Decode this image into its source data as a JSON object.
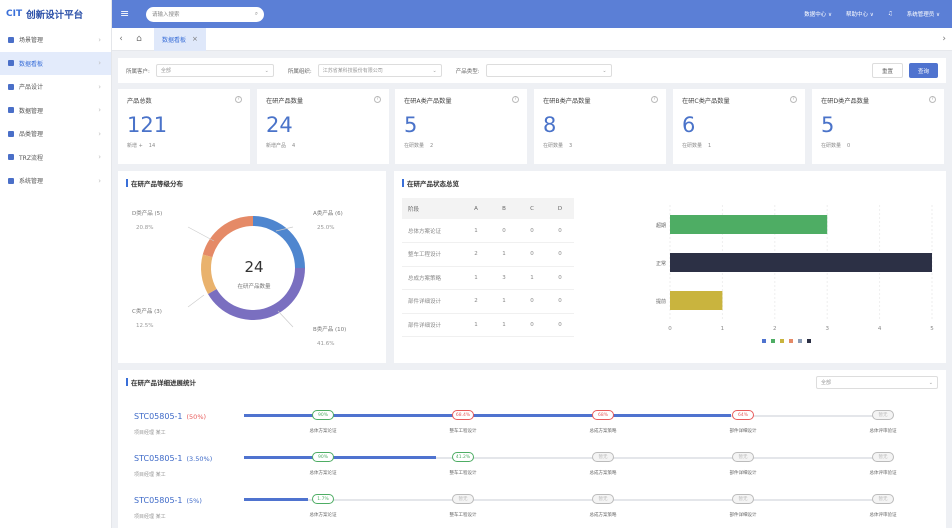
{
  "app": {
    "logo_mark": "CIT",
    "logo_text": "创新设计平台"
  },
  "sidebar": {
    "items": [
      {
        "label": "场景管理",
        "active": false
      },
      {
        "label": "数据看板",
        "active": true
      },
      {
        "label": "产品设计",
        "active": false
      },
      {
        "label": "数据管理",
        "active": false
      },
      {
        "label": "品类管理",
        "active": false
      },
      {
        "label": "TRZ流程",
        "active": false
      },
      {
        "label": "系统管理",
        "active": false
      }
    ]
  },
  "topbar": {
    "search_placeholder": "请输入搜索",
    "links": [
      "数据中心 ∨",
      "帮助中心 ∨",
      "♫",
      "系统管理员 ∨"
    ]
  },
  "tabs": {
    "active_label": "数据看板"
  },
  "filter": {
    "fields": [
      {
        "label": "所属客户:",
        "value": "全部"
      },
      {
        "label": "所属组织:",
        "value": "江苏省某科技股份有限公司"
      },
      {
        "label": "产品类型:",
        "value": ""
      }
    ],
    "reset_label": "重置",
    "query_label": "查询"
  },
  "stats": [
    {
      "title": "产品总数",
      "value": "121",
      "sub": "新增 +",
      "sub_value": "14"
    },
    {
      "title": "在研产品数量",
      "value": "24",
      "sub": "新增产品",
      "sub_value": "4"
    },
    {
      "title": "在研A类产品数量",
      "value": "5",
      "sub": "在研数量",
      "sub_value": "2"
    },
    {
      "title": "在研B类产品数量",
      "value": "8",
      "sub": "在研数量",
      "sub_value": "3"
    },
    {
      "title": "在研C类产品数量",
      "value": "6",
      "sub": "在研数量",
      "sub_value": "1"
    },
    {
      "title": "在研D类产品数量",
      "value": "5",
      "sub": "在研数量",
      "sub_value": "0"
    }
  ],
  "donut_panel": {
    "title": "在研产品等级分布",
    "center_value": "24",
    "center_label": "在研产品数量",
    "chart_data": {
      "type": "pie",
      "slices": [
        {
          "name": "A类产品",
          "count": 6,
          "pct": "25.0%",
          "color": "#4f86cf"
        },
        {
          "name": "B类产品",
          "count": 10,
          "pct": "41.6%",
          "color": "#7a6fc0"
        },
        {
          "name": "C类产品",
          "count": 3,
          "pct": "12.5%",
          "color": "#e9b26d"
        },
        {
          "name": "D类产品",
          "count": 5,
          "pct": "20.8%",
          "color": "#e58a67"
        }
      ]
    }
  },
  "status_panel": {
    "title": "在研产品状态总览",
    "table": {
      "headers": [
        "阶段",
        "A",
        "B",
        "C",
        "D"
      ],
      "rows": [
        [
          "总体方案论证",
          "1",
          "0",
          "0",
          "0"
        ],
        [
          "整车工程设计",
          "2",
          "1",
          "0",
          "0"
        ],
        [
          "总成方案策略",
          "1",
          "3",
          "1",
          "0"
        ],
        [
          "部件详细设计",
          "2",
          "1",
          "0",
          "0"
        ],
        [
          "部件详细设计",
          "1",
          "1",
          "0",
          "0"
        ]
      ]
    },
    "chart_data": {
      "type": "bar",
      "orientation": "horizontal",
      "categories": [
        "超期",
        "正常",
        "提前"
      ],
      "values": [
        3,
        5,
        1
      ],
      "colors": [
        "#4ead64",
        "#2c3045",
        "#c9b43e"
      ],
      "xlim": [
        0,
        5
      ],
      "xticks": [
        "0",
        "1",
        "2",
        "3",
        "4",
        "5"
      ]
    }
  },
  "progress_panel": {
    "title": "在研产品详细进展统计",
    "dropdown_value": "全部",
    "stages": [
      "总体方案论证",
      "整车工程设计",
      "总成方案策略",
      "部件详细设计",
      "总体评审验证"
    ],
    "rows": [
      {
        "code": "STC05805-1",
        "pct": "(50%)",
        "pct_color": "#e85c5c",
        "owner": "项目经理  某工",
        "badges": [
          "90%",
          "68.4%",
          "68%",
          "64%",
          "暂无"
        ],
        "badge_states": [
          "green",
          "red",
          "red",
          "red",
          "gray"
        ],
        "fill": 0.76
      },
      {
        "code": "STC05805-1",
        "pct": "(3.50%)",
        "pct_color": "#3e6ac8",
        "owner": "项目经理  某工",
        "badges": [
          "90%",
          "41.2%",
          "暂无",
          "暂无",
          "暂无"
        ],
        "badge_states": [
          "green",
          "green",
          "gray",
          "gray",
          "gray"
        ],
        "fill": 0.3
      },
      {
        "code": "STC05805-1",
        "pct": "(5%)",
        "pct_color": "#3e6ac8",
        "owner": "项目经理  某工",
        "badges": [
          "1.7%",
          "暂无",
          "暂无",
          "暂无",
          "暂无"
        ],
        "badge_states": [
          "green",
          "gray",
          "gray",
          "gray",
          "gray"
        ],
        "fill": 0.1
      }
    ]
  }
}
